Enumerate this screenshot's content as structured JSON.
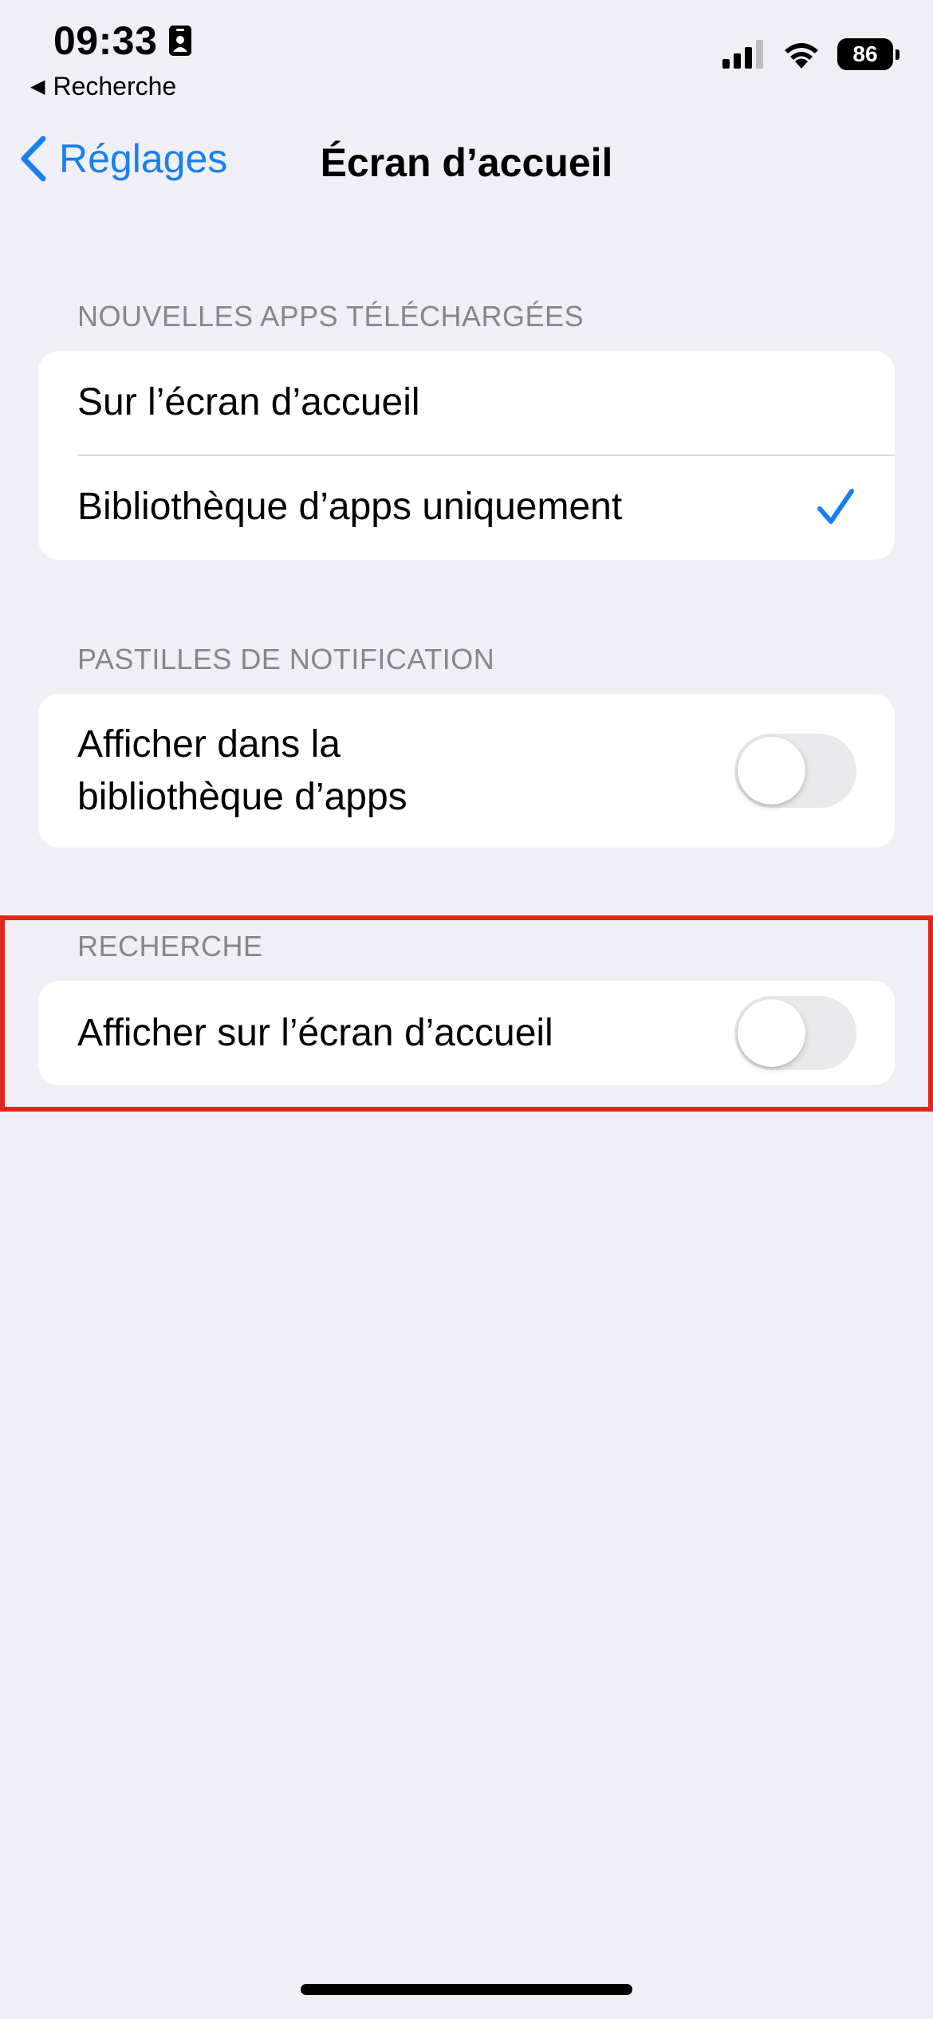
{
  "status_bar": {
    "time": "09:33",
    "back_app_label": "Recherche",
    "battery_level": "86",
    "icons": [
      "id-card-icon",
      "cellular-signal-icon",
      "wifi-icon",
      "battery-icon"
    ]
  },
  "nav": {
    "back_label": "Réglages",
    "title": "Écran d’accueil"
  },
  "sections": {
    "new_apps": {
      "header": "NOUVELLES APPS TÉLÉCHARGÉES",
      "options": [
        {
          "label": "Sur l’écran d’accueil",
          "selected": false
        },
        {
          "label": "Bibliothèque d’apps uniquement",
          "selected": true
        }
      ]
    },
    "badges": {
      "header": "PASTILLES DE NOTIFICATION",
      "toggle_label_line1": "Afficher dans la",
      "toggle_label_line2": "bibliothèque d’apps",
      "toggle_on": false
    },
    "search": {
      "header": "RECHERCHE",
      "toggle_label": "Afficher sur l’écran d’accueil",
      "toggle_on": false
    }
  },
  "colors": {
    "accent": "#1A7FF0",
    "background": "#F0EFF5",
    "highlight_border": "#E0261D",
    "toggle_off": "#E9E9EB"
  }
}
